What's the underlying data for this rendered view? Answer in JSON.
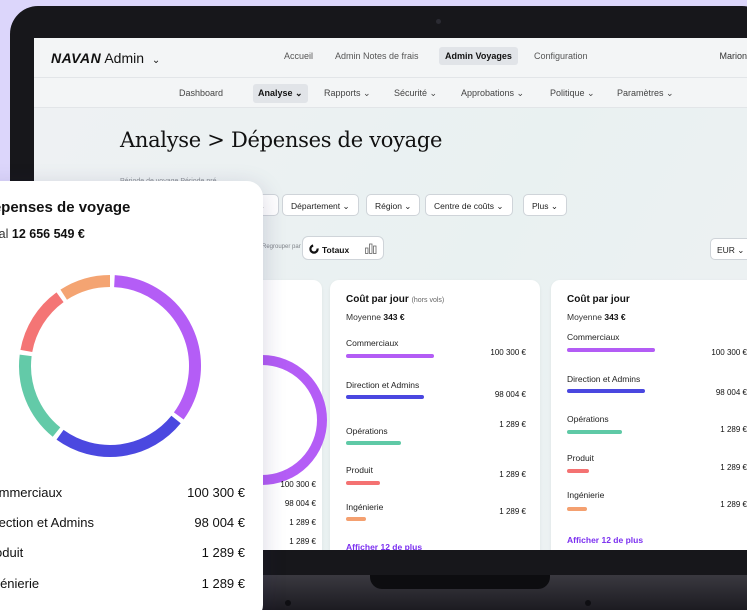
{
  "app": {
    "logo_brand": "NAVAN",
    "logo_suffix": "Admin",
    "logo_caret": "⌄",
    "user_name": "Marion"
  },
  "top_nav": {
    "items": [
      {
        "label": "Accueil"
      },
      {
        "label": "Admin Notes de frais"
      },
      {
        "label": "Admin Voyages"
      },
      {
        "label": "Configuration"
      }
    ]
  },
  "sub_nav": {
    "items": [
      {
        "label": "Dashboard"
      },
      {
        "label": "Analyse ⌄"
      },
      {
        "label": "Rapports ⌄"
      },
      {
        "label": "Sécurité ⌄"
      },
      {
        "label": "Approbations ⌄"
      },
      {
        "label": "Politique ⌄"
      },
      {
        "label": "Paramètres ⌄"
      }
    ]
  },
  "page": {
    "title": "Analyse > Dépenses de voyage",
    "breadcrumb_small": "Période de voyage     Période pré"
  },
  "filters": {
    "items": [
      {
        "label": "⌄"
      },
      {
        "label": "Département ⌄"
      },
      {
        "label": "Région ⌄"
      },
      {
        "label": "Centre de coûts ⌄"
      },
      {
        "label": "Plus ⌄"
      }
    ],
    "group_by_label": "Regrouper par",
    "toggle_totals": "Totaux",
    "currency": "EUR ⌄"
  },
  "cards": [
    {
      "title": "Coût par jour",
      "title_note": "(hors vols)",
      "avg_label": "Moyenne",
      "avg_value": "343 €",
      "rows": [
        {
          "label": "Commerciaux",
          "value": "100 300 €",
          "color": "#b35cf5",
          "fraction": 0.88
        },
        {
          "label": "Direction et Admins",
          "value": "98 004 €",
          "color": "#4a47e0",
          "fraction": 0.78
        },
        {
          "label": "Opérations",
          "value": "1 289 €",
          "color": "#5fc9a6",
          "fraction": 0.55
        },
        {
          "label": "Produit",
          "value": "1 289 €",
          "color": "#f47272",
          "fraction": 0.34
        },
        {
          "label": "Ingénierie",
          "value": "1 289 €",
          "color": "#f4a070",
          "fraction": 0.2
        }
      ],
      "more": "Afficher 12 de plus"
    },
    {
      "title": "Coût par jour",
      "title_note": "",
      "avg_label": "Moyenne",
      "avg_value": "343 €",
      "rows": [
        {
          "label": "Commerciaux",
          "value": "100 300 €",
          "color": "#b35cf5",
          "fraction": 0.88
        },
        {
          "label": "Direction et Admins",
          "value": "98 004 €",
          "color": "#4a47e0",
          "fraction": 0.78
        },
        {
          "label": "Opérations",
          "value": "1 289 €",
          "color": "#5fc9a6",
          "fraction": 0.55
        },
        {
          "label": "Produit",
          "value": "1 289 €",
          "color": "#f47272",
          "fraction": 0.22
        },
        {
          "label": "Ingénierie",
          "value": "1 289 €",
          "color": "#f4a070",
          "fraction": 0.2
        }
      ],
      "more": "Afficher 12 de plus"
    }
  ],
  "hidden_card_values": [
    "100 300 €",
    "98 004 €",
    "1 289 €",
    "1 289 €"
  ],
  "float_card": {
    "title": "Dépenses de voyage",
    "total_label": "Total",
    "total_value": "12 656 549 €",
    "legend": [
      {
        "label": "Commerciaux",
        "value": "100 300 €"
      },
      {
        "label": "Direction et Admins",
        "value": "98 004 €"
      },
      {
        "label": "Produit",
        "value": "1 289 €"
      },
      {
        "label": "Ingénierie",
        "value": "1 289 €"
      }
    ]
  },
  "chart_data": {
    "type": "pie",
    "title": "Dépenses de voyage",
    "categories": [
      "Commerciaux",
      "Direction et Admins",
      "Opérations",
      "Produit",
      "Ingénierie"
    ],
    "values": [
      35,
      25,
      17,
      13,
      10
    ],
    "colors": [
      "#b45df6",
      "#4b48e0",
      "#63caa8",
      "#f47575",
      "#f4a472"
    ],
    "legend": "below"
  }
}
